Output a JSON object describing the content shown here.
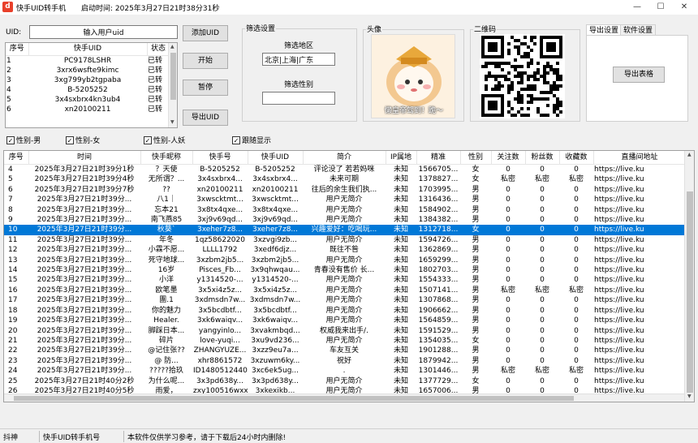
{
  "window": {
    "title": "快手UID转手机",
    "start_time": "启动时间: 2025年3月27日21时38分31秒",
    "icon_letter": "d",
    "min": "—",
    "max": "☐",
    "close": "✕"
  },
  "uid": {
    "label": "UID:",
    "placeholder": "输入用户uid",
    "value": "输入用户uid"
  },
  "uid_list": {
    "headers": [
      "序号",
      "快手UID",
      "状态"
    ],
    "rows": [
      [
        "1",
        "PC9178LSHR",
        "已转"
      ],
      [
        "2",
        "3xrx6wsfte9kimc",
        "已转"
      ],
      [
        "3",
        "3xg799yb2tgpaba",
        "已转"
      ],
      [
        "4",
        "B-5205252",
        "已转"
      ],
      [
        "5",
        "3x4sxbrx4kn3ub4",
        "已转"
      ],
      [
        "6",
        "xn20100211",
        "已转"
      ]
    ]
  },
  "buttons": {
    "add": "添加UID",
    "start": "开始",
    "pause": "暂停",
    "export_uid": "导出UID",
    "export_table": "导出表格"
  },
  "filter": {
    "group": "筛选设置",
    "region_label": "筛选地区",
    "region_value": "北京|上海|广东",
    "gender_label": "筛选性别",
    "gender_value": ""
  },
  "avatar": {
    "group": "头像",
    "caption": "懒皇帝驾到！跪～"
  },
  "qrcode": {
    "group": "二维码"
  },
  "tabs": {
    "export": "导出设置",
    "software": "软件设置"
  },
  "checkboxes": [
    {
      "label": "性别-男",
      "checked": true
    },
    {
      "label": "性别-女",
      "checked": true
    },
    {
      "label": "性别-人妖",
      "checked": true
    },
    {
      "label": "跟随显示",
      "checked": true
    }
  ],
  "grid": {
    "headers": [
      "序号",
      "时间",
      "快手昵称",
      "快手号",
      "快手UID",
      "简介",
      "IP属地",
      "精准",
      "性别",
      "关注数",
      "粉丝数",
      "收藏数",
      "直播间地址"
    ],
    "rows": [
      [
        "4",
        "2025年3月27日21时39分1秒",
        "？天使",
        "B-5205252",
        "B-5205252",
        "评论没了  若若妈咪",
        "未知",
        "1566705...",
        "女",
        "0",
        "0",
        "0",
        "https://live.ku"
      ],
      [
        "5",
        "2025年3月27日21时39分4秒",
        "无所谓？...",
        "3x4sxbrx4...",
        "3x4sxbrx4...",
        "未来可期",
        "未知",
        "1378827...",
        "女",
        "私密",
        "私密",
        "私密",
        "https://live.ku"
      ],
      [
        "6",
        "2025年3月27日21时39分7秒",
        "??",
        "xn20100211",
        "xn20100211",
        "往后的余生我们执...",
        "未知",
        "1703995...",
        "男",
        "0",
        "0",
        "0",
        "https://live.ku"
      ],
      [
        "7",
        "2025年3月27日21时39分...",
        "八1｜",
        "3xwscktmt...",
        "3xwscktmt...",
        "用户无简介",
        "未知",
        "1316436...",
        "男",
        "0",
        "0",
        "0",
        "https://live.ku"
      ],
      [
        "8",
        "2025年3月27日21时39分...",
        "忘本21",
        "3x8tx4qxe...",
        "3x8tx4qxe...",
        "用户无简介",
        "未知",
        "1584902...",
        "男",
        "0",
        "0",
        "0",
        "https://live.ku"
      ],
      [
        "9",
        "2025年3月27日21时39分...",
        "南飞燕85",
        "3xj9v69qd...",
        "3xj9v69qd...",
        "用户无简介",
        "未知",
        "1384382...",
        "男",
        "0",
        "0",
        "0",
        "https://live.ku"
      ],
      [
        "10",
        "2025年3月27日21时39分...",
        "秋葵`",
        "3xeher7z8...",
        "3xeher7z8...",
        "兴趣爱好：吃喝玩...",
        "未知",
        "1312718...",
        "女",
        "0",
        "0",
        "0",
        "https://live.ku"
      ],
      [
        "11",
        "2025年3月27日21时39分...",
        "年冬",
        "1qz58622020",
        "3xzvgi9zb...",
        "用户无简介",
        "未知",
        "1594726...",
        "男",
        "0",
        "0",
        "0",
        "https://live.ku"
      ],
      [
        "12",
        "2025年3月27日21时39分...",
        "小霖不愿...",
        "LLLL1792",
        "3xedf6djz...",
        "既往不咎",
        "未知",
        "1362869...",
        "男",
        "0",
        "0",
        "0",
        "https://live.ku"
      ],
      [
        "13",
        "2025年3月27日21时39分...",
        "死守地球...",
        "3xzbm2jb5...",
        "3xzbm2jb5...",
        "用户无简介",
        "未知",
        "1659299...",
        "男",
        "0",
        "0",
        "0",
        "https://live.ku"
      ],
      [
        "14",
        "2025年3月27日21时39分...",
        "16岁",
        "Pisces_Fb...",
        "3x9qhwqau...",
        "青春没有售价 长...",
        "未知",
        "1802703...",
        "男",
        "0",
        "0",
        "0",
        "https://live.ku"
      ],
      [
        "15",
        "2025年3月27日21时39分...",
        "小洋",
        "y1314520-...",
        "y1314520-...",
        "用户无简介",
        "未知",
        "1554333...",
        "男",
        "0",
        "0",
        "0",
        "https://live.ku"
      ],
      [
        "16",
        "2025年3月27日21时39分...",
        "欧笔墨",
        "3x5xi4z5z...",
        "3x5xi4z5z...",
        "用户无简介",
        "未知",
        "1507141...",
        "男",
        "私密",
        "私密",
        "私密",
        "https://live.ku"
      ],
      [
        "17",
        "2025年3月27日21时39分...",
        "團.1",
        "3xdmsdn7w...",
        "3xdmsdn7w...",
        "用户无简介",
        "未知",
        "1307868...",
        "男",
        "0",
        "0",
        "0",
        "https://live.ku"
      ],
      [
        "18",
        "2025年3月27日21时39分...",
        "你的魅力",
        "3x5bcdbtf...",
        "3x5bcdbtf...",
        "用户无简介",
        "未知",
        "1906662...",
        "男",
        "0",
        "0",
        "0",
        "https://live.ku"
      ],
      [
        "19",
        "2025年3月27日21时39分...",
        "Healer.",
        "3xk6waiqv...",
        "3xk6waiqv...",
        "用户无简介",
        "未知",
        "1564859...",
        "男",
        "0",
        "0",
        "0",
        "https://live.ku"
      ],
      [
        "20",
        "2025年3月27日21时39分...",
        "脚踩日本...",
        "yangyinlo...",
        "3xvakmbqd...",
        "权威我来出手/.",
        "未知",
        "1591529...",
        "男",
        "0",
        "0",
        "0",
        "https://live.ku"
      ],
      [
        "21",
        "2025年3月27日21时39分...",
        "碎片",
        "love-yuqi...",
        "3xu9vd236...",
        "用户无简介",
        "未知",
        "1354035...",
        "女",
        "0",
        "0",
        "0",
        "https://live.ku"
      ],
      [
        "22",
        "2025年3月27日21时39分...",
        "@记住张??",
        "ZHANGYUZE...",
        "3xzz9eu7a...",
        "车友互关",
        "未知",
        "1901288...",
        "男",
        "0",
        "0",
        "0",
        "https://live.ku"
      ],
      [
        "23",
        "2025年3月27日21时39分...",
        "@  防...",
        "xhr8861572",
        "3xzuwm6ky...",
        "祝好",
        "未知",
        "1879942...",
        "男",
        "0",
        "0",
        "0",
        "https://live.ku"
      ],
      [
        "24",
        "2025年3月27日21时39分...",
        "?????拾玖",
        "ID1480512440",
        "3xc6ek5ug...",
        ".",
        "未知",
        "1301446...",
        "男",
        "私密",
        "私密",
        "私密",
        "https://live.ku"
      ],
      [
        "25",
        "2025年3月27日21时40分2秒",
        "为什么呢...",
        "3x3pd638y...",
        "3x3pd638y...",
        "用户无简介",
        "未知",
        "1377729...",
        "女",
        "0",
        "0",
        "0",
        "https://live.ku"
      ],
      [
        "26",
        "2025年3月27日21时40分5秒",
        "雨爱，",
        "zxy100516wxx",
        "3xkexikb...",
        "用户无简介",
        "未知",
        "1657006...",
        "男",
        "0",
        "0",
        "0",
        "https://live.ku"
      ]
    ],
    "selected_row": "10"
  },
  "status": {
    "s1": "抖神",
    "s2": "快手UID转手机号",
    "s3": "本软件仅供学习参考，请于下载后24小时内删除!"
  }
}
